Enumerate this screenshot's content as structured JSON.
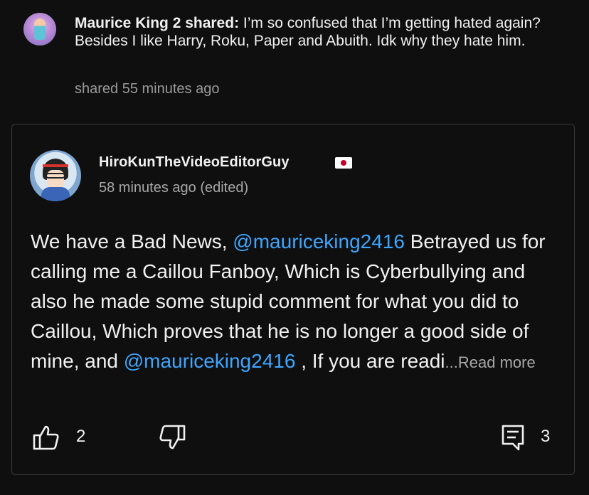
{
  "share": {
    "author": "Maurice King 2 shared:",
    "message": " I’m so confused that I’m getting hated again? Besides I like Harry, Roku, Paper and Abuith. Idk why they hate him.",
    "time": "shared 55 minutes ago",
    "avatar_icon": "avatar-icon"
  },
  "comment": {
    "author": "HiroKunTheVideoEditorGuy",
    "flag_icon": "japan-flag-icon",
    "time": "58 minutes ago (edited)",
    "text_1": "We have a Bad News, ",
    "mention_1": "@mauriceking2416",
    "text_2": " Betrayed us for calling me a Caillou Fanboy, Which is Cyberbullying and also he made some stupid comment for what you did to Caillou, Which proves that he is no longer a good side of mine, and ",
    "mention_2": "@mauriceking2416",
    "text_3": " , If you are readi",
    "read_more": "...Read more",
    "like_count": "2",
    "reply_count": "3"
  },
  "colors": {
    "background": "#0f0f0f",
    "text": "#f1f1f1",
    "mention": "#3ea6ff",
    "secondary": "#a8a8a8",
    "border": "#3a3a3a"
  }
}
